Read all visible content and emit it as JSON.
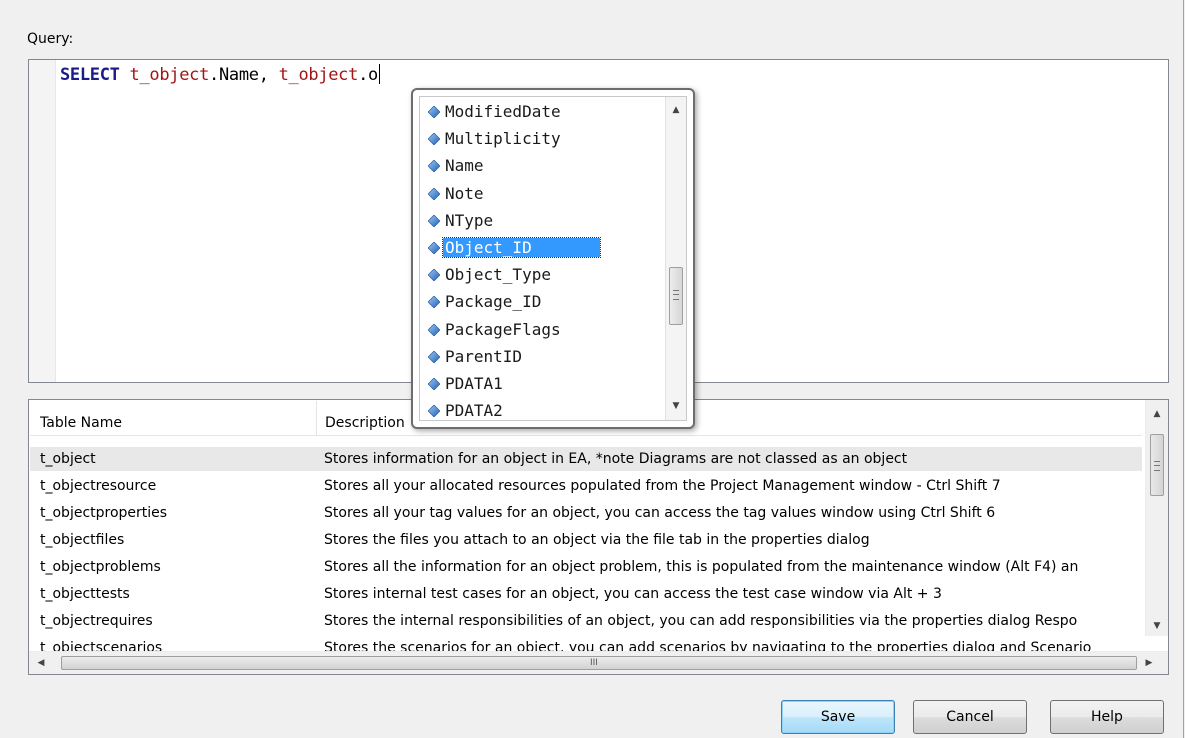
{
  "query": {
    "label": "Query:",
    "sql_keyword": "SELECT",
    "sql_table1": "t_object",
    "sql_part1": ".Name, ",
    "sql_table2": "t_object",
    "sql_part2": ".o"
  },
  "autocomplete": {
    "icon": "field-diamond-icon",
    "items": [
      "ModifiedDate",
      "Multiplicity",
      "Name",
      "Note",
      "NType",
      "Object_ID",
      "Object_Type",
      "Package_ID",
      "PackageFlags",
      "ParentID",
      "PDATA1",
      "PDATA2"
    ],
    "selected_index": 5
  },
  "table_list": {
    "headers": [
      "Table Name",
      "Description"
    ],
    "rows": [
      [
        "t_object",
        "Stores information for an object in EA, *note Diagrams are not classed as an object"
      ],
      [
        "t_objectresource",
        "Stores all your allocated resources populated from the Project Management window - Ctrl Shift 7"
      ],
      [
        "t_objectproperties",
        "Stores all your tag values for an object, you can access the tag values window using Ctrl Shift 6"
      ],
      [
        "t_objectfiles",
        "Stores the files you attach to an object via the file tab in the properties dialog"
      ],
      [
        "t_objectproblems",
        "Stores all the information for an object problem, this is populated from the maintenance window (Alt F4) an"
      ],
      [
        "t_objecttests",
        "Stores internal test cases for an object, you can access the test case window via Alt + 3"
      ],
      [
        "t_objectrequires",
        "Stores the internal responsibilities of an object, you can add responsibilities via the properties dialog Respo"
      ],
      [
        "t_objectscenarios",
        "Stores the scenarios for an object, you can add scenarios by navigating to the properties dialog and Scenario"
      ]
    ],
    "selected_index": 0,
    "scroll_glyph": "III"
  },
  "buttons": {
    "save": "Save",
    "cancel": "Cancel",
    "help": "Help"
  },
  "colors": {
    "sql_keyword": "#1a1a8a",
    "sql_table": "#a31515",
    "selection": "#3399ff"
  }
}
